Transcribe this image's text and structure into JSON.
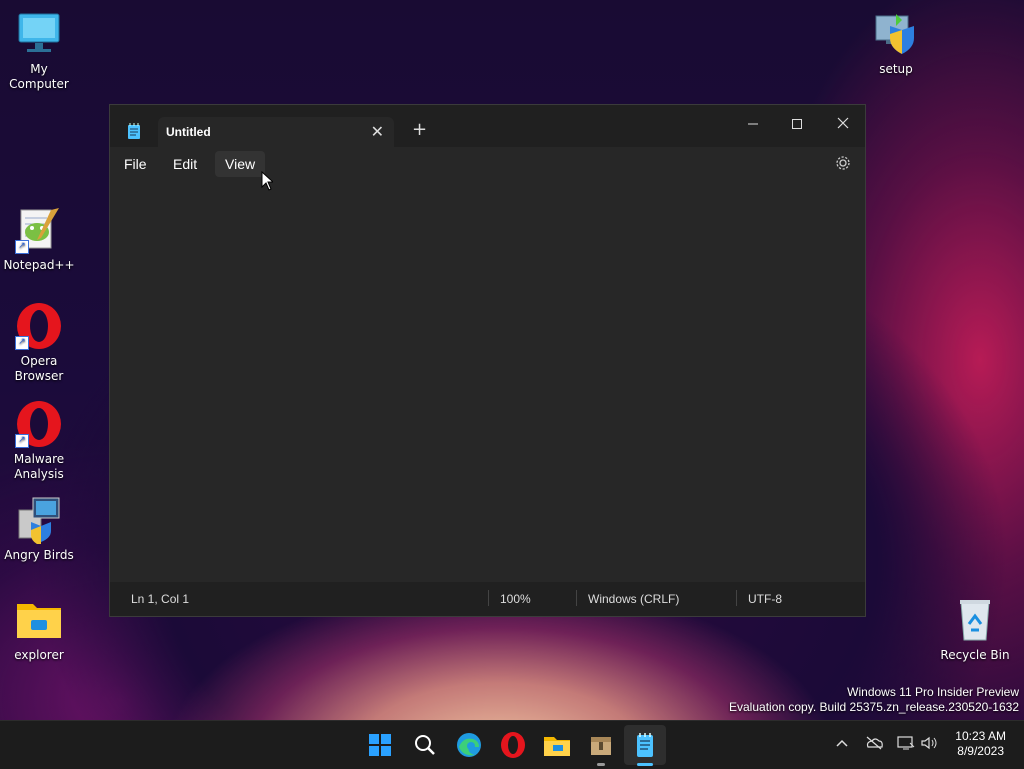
{
  "desktop": {
    "icons": [
      {
        "label": "My Computer",
        "icon": "monitor-icon"
      },
      {
        "label": "setup",
        "icon": "setup-shield-icon"
      },
      {
        "label": "Notepad++",
        "icon": "notepadpp-icon"
      },
      {
        "label": "Opera Browser",
        "icon": "opera-icon"
      },
      {
        "label": "Malware Analysis",
        "icon": "opera-icon"
      },
      {
        "label": "Angry Birds",
        "icon": "installer-icon"
      },
      {
        "label": "explorer",
        "icon": "folder-icon"
      },
      {
        "label": "Recycle Bin",
        "icon": "recycle-bin-icon"
      }
    ]
  },
  "notepad": {
    "tab_title": "Untitled",
    "new_tab": "+",
    "menu": [
      "File",
      "Edit",
      "View"
    ],
    "status": {
      "position": "Ln 1, Col 1",
      "zoom": "100%",
      "line_ending": "Windows (CRLF)",
      "encoding": "UTF-8"
    }
  },
  "watermark": {
    "line1": "Windows 11 Pro Insider Preview",
    "line2": "Evaluation copy. Build 25375.zn_release.230520-1632"
  },
  "taskbar": {
    "apps": [
      "start-icon",
      "search-icon",
      "edge-icon",
      "opera-icon",
      "file-explorer-icon",
      "archive-icon",
      "notepad-icon"
    ],
    "clock": {
      "time": "10:23 AM",
      "date": "8/9/2023"
    }
  },
  "colors": {
    "accent": "#4cc2ff",
    "window_bg": "#272727",
    "titlebar_bg": "#202020"
  }
}
